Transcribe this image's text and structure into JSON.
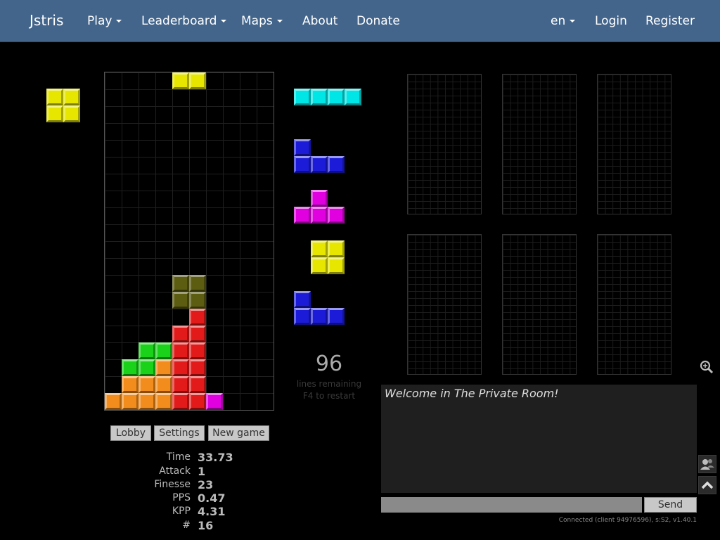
{
  "nav": {
    "brand": "Jstris",
    "items": [
      {
        "label": "Play",
        "dropdown": true
      },
      {
        "label": "Leaderboard",
        "dropdown": true
      },
      {
        "label": "Maps",
        "dropdown": true
      },
      {
        "label": "About",
        "dropdown": false
      },
      {
        "label": "Donate",
        "dropdown": false
      }
    ],
    "right": [
      {
        "label": "en",
        "dropdown": true
      },
      {
        "label": "Login",
        "dropdown": false
      },
      {
        "label": "Register",
        "dropdown": false
      }
    ]
  },
  "colors": {
    "navbar": "#43658b",
    "I": "#00e5e5",
    "O": "#e6e600",
    "T": "#e000e0",
    "J": "#1c1cd8",
    "L": "#f28c1c",
    "S": "#19d219",
    "Z": "#e21a1a",
    "ghost": "#6e6e14"
  },
  "game": {
    "hold": "O",
    "falling_piece": "O",
    "ghost_piece": "O",
    "next_queue": [
      "I",
      "J",
      "T",
      "O",
      "J"
    ],
    "board_rows": [
      "....................",
      "....................",
      "....................",
      "....................",
      "....................",
      "....................",
      "....................",
      "....................",
      "....................",
      "....................",
      "....................",
      "....................",
      "....................",
      "....................",
      "....................",
      "....................",
      "....................",
      "....................",
      "....................",
      ".....Z....",
      "....ZZ....",
      "..SSZZ....",
      ".SSLZZ....",
      ".LLLZZ....",
      "LLLLZZT..."
    ]
  },
  "counter": {
    "value": "96",
    "label": "lines remaining",
    "hint": "F4 to restart"
  },
  "buttons": {
    "lobby": "Lobby",
    "settings": "Settings",
    "new_game": "New game"
  },
  "stats": [
    {
      "label": "Time",
      "value": "33.73"
    },
    {
      "label": "Attack",
      "value": "1"
    },
    {
      "label": "Finesse",
      "value": "23"
    },
    {
      "label": "PPS",
      "value": "0.47"
    },
    {
      "label": "KPP",
      "value": "4.31"
    },
    {
      "label": "#",
      "value": "16"
    }
  ],
  "chat": {
    "message": "Welcome in The Private Room!",
    "input_value": "",
    "send_label": "Send",
    "status": "Connected (client 94976596), s:S2, v1.40.1"
  },
  "icons": {
    "zoom": "zoom-icon",
    "users": "users-icon",
    "scroll_top": "chevron-up-icon"
  }
}
